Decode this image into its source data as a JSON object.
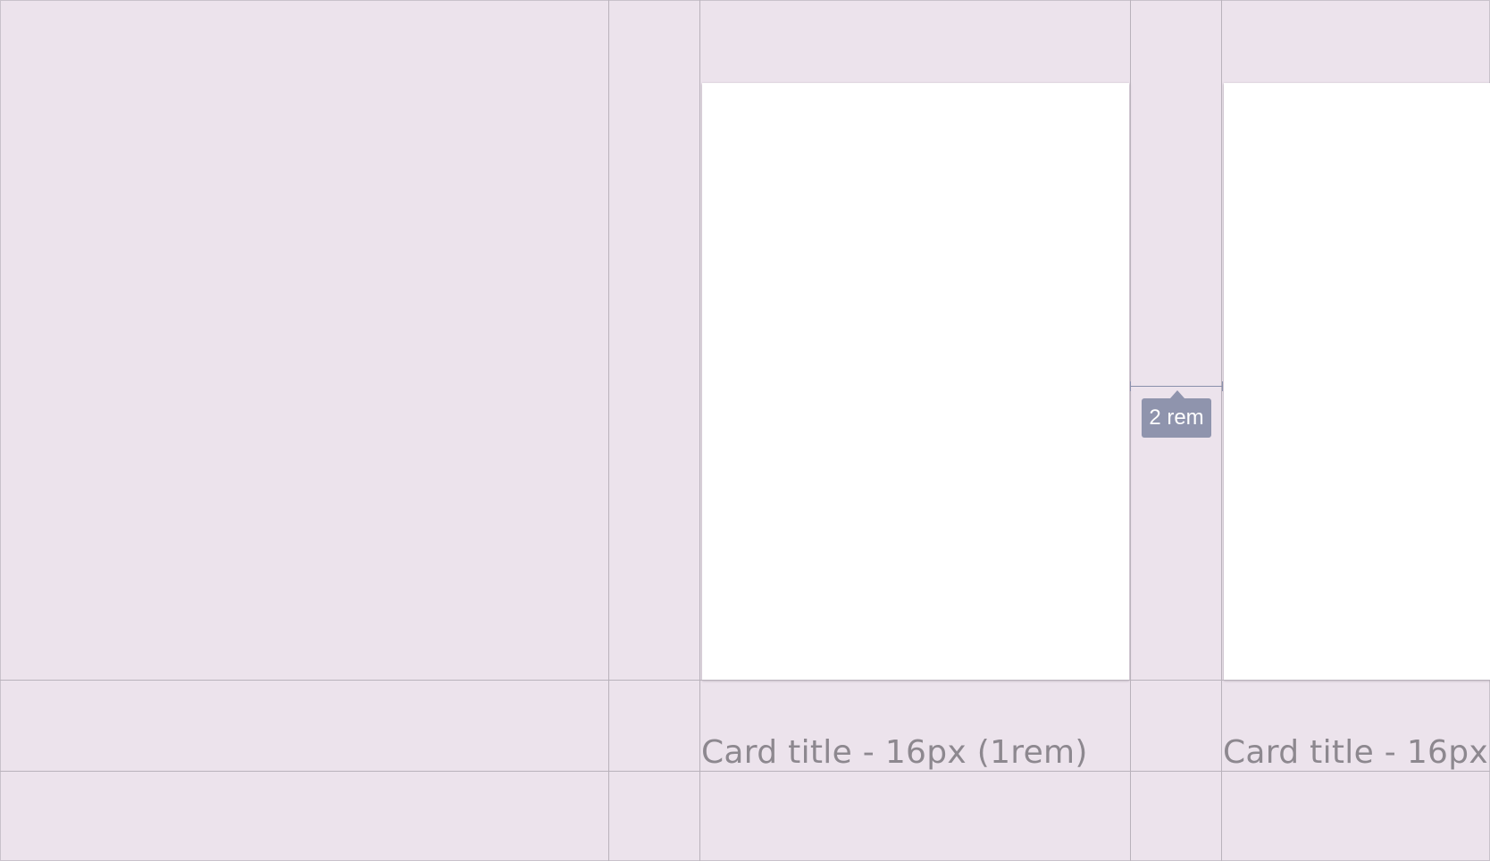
{
  "diagram": {
    "cards": [
      {
        "title": "Card title - 16px (1rem)"
      },
      {
        "title": "Card title - 16px"
      }
    ],
    "gap_label": "2 rem"
  },
  "colors": {
    "background": "#ece3ec",
    "card": "#ffffff",
    "guide_line": "#b9b2bb",
    "title_text": "#8d888f",
    "badge": "#8f94ad"
  }
}
